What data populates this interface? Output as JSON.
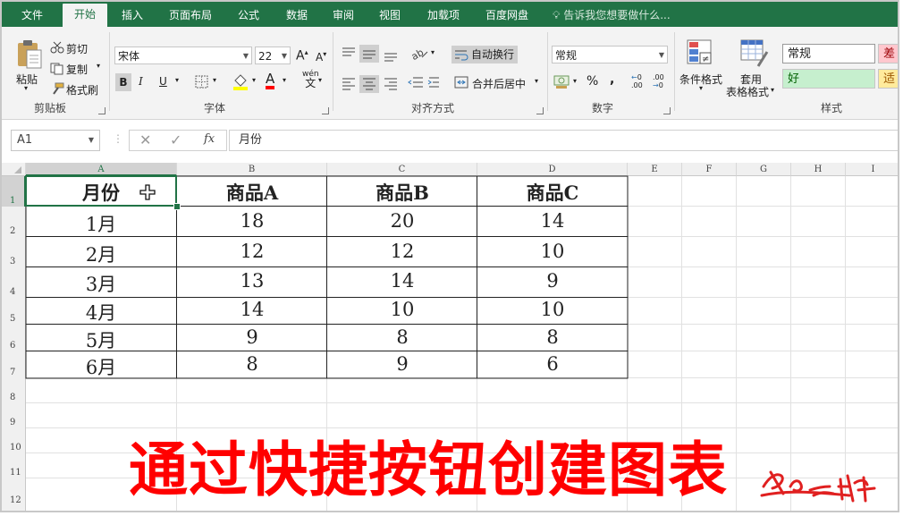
{
  "tabs": [
    "文件",
    "开始",
    "插入",
    "页面布局",
    "公式",
    "数据",
    "审阅",
    "视图",
    "加载项",
    "百度网盘"
  ],
  "active_tab": "开始",
  "tell_me": "告诉我您想要做什么...",
  "ribbon": {
    "clipboard": {
      "paste": "粘贴",
      "cut": "剪切",
      "copy": "复制",
      "format_painter": "格式刷",
      "group": "剪贴板"
    },
    "font": {
      "name": "宋体",
      "size": "22",
      "bold": "B",
      "italic": "I",
      "underline": "U",
      "font_color_glyph": "A",
      "pinyin_top": "wén",
      "pinyin_bottom": "文",
      "group": "字体",
      "grow": "A",
      "shrink": "A"
    },
    "alignment": {
      "wrap_text": "自动换行",
      "merge_center": "合并后居中",
      "group": "对齐方式"
    },
    "number": {
      "format": "常规",
      "percent": "%",
      "comma": ",",
      "inc_decimal": ".00",
      "dec_decimal": ".00",
      "group": "数字"
    },
    "styles": {
      "conditional": "条件格式",
      "table_top": "套用",
      "table_bottom": "表格格式",
      "normal": "常规",
      "bad": "差",
      "good": "好",
      "neutral": "适",
      "group": "样式"
    }
  },
  "formula_bar": {
    "name_box": "A1",
    "fx": "fx",
    "value": "月份"
  },
  "columns": [
    "A",
    "B",
    "C",
    "D",
    "E",
    "F",
    "G",
    "H",
    "I"
  ],
  "rows": [
    "1",
    "2",
    "3",
    "4",
    "5",
    "6",
    "7",
    "8",
    "9",
    "10",
    "11",
    "12"
  ],
  "table": {
    "headers": [
      "月份",
      "商品A",
      "商品B",
      "商品C"
    ],
    "rows": [
      [
        "1月",
        "18",
        "20",
        "14"
      ],
      [
        "2月",
        "12",
        "12",
        "10"
      ],
      [
        "3月",
        "13",
        "14",
        "9"
      ],
      [
        "4月",
        "14",
        "10",
        "10"
      ],
      [
        "5月",
        "9",
        "8",
        "8"
      ],
      [
        "6月",
        "8",
        "9",
        "6"
      ]
    ]
  },
  "caption": "通过快捷按钮创建图表",
  "colors": {
    "excel_green": "#217346",
    "caption_red": "#ff0000",
    "good_bg": "#c6efce",
    "bad_bg": "#ffc7ce",
    "neutral_bg": "#ffeb9c"
  }
}
